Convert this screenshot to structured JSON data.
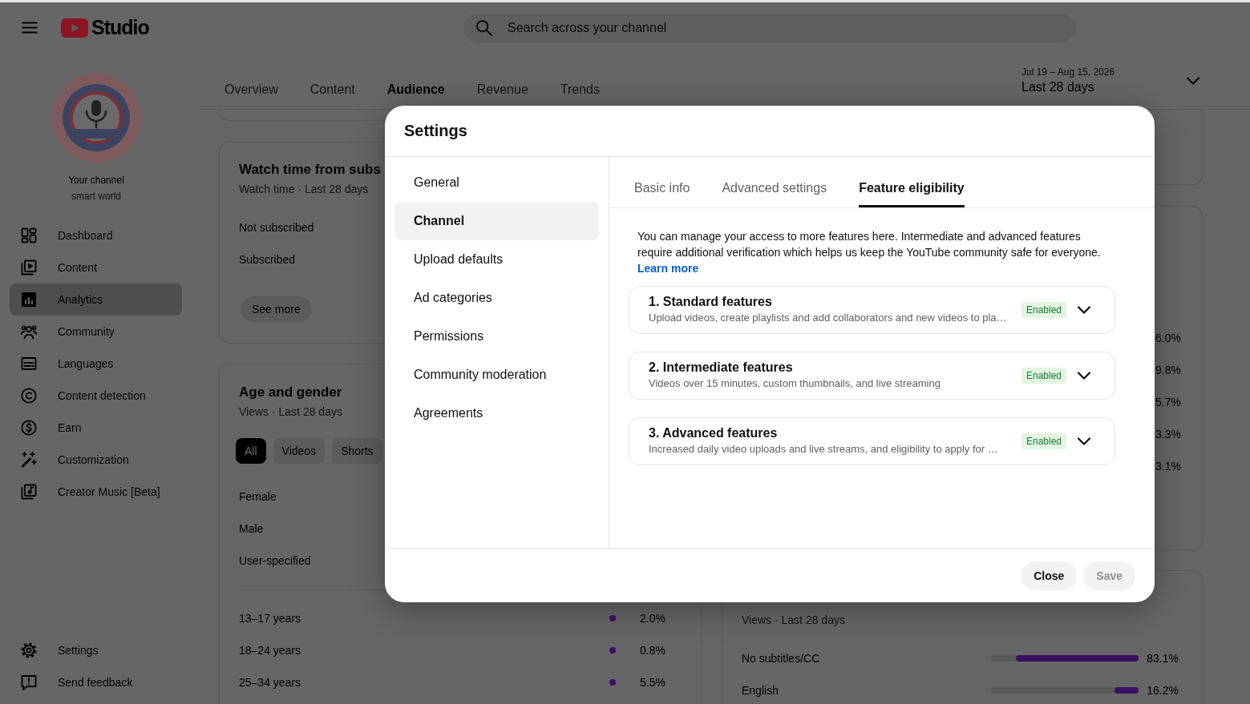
{
  "header": {
    "logo_text": "Studio",
    "search": {
      "placeholder": "Search across your channel"
    }
  },
  "sidebar": {
    "channel": {
      "label": "Your channel",
      "name": "smart world"
    },
    "items": [
      {
        "label": "Dashboard",
        "selected": false
      },
      {
        "label": "Content",
        "selected": false
      },
      {
        "label": "Analytics",
        "selected": true
      },
      {
        "label": "Community",
        "selected": false
      },
      {
        "label": "Languages",
        "selected": false
      },
      {
        "label": "Content detection",
        "selected": false
      },
      {
        "label": "Earn",
        "selected": false
      },
      {
        "label": "Customization",
        "selected": false
      },
      {
        "label": "Creator Music [Beta]",
        "selected": false
      }
    ],
    "footer_items": [
      {
        "label": "Settings",
        "selected": false
      },
      {
        "label": "Send feedback",
        "selected": false
      }
    ]
  },
  "tabs": [
    {
      "label": "Overview",
      "selected": false
    },
    {
      "label": "Content",
      "selected": false
    },
    {
      "label": "Audience",
      "selected": true
    },
    {
      "label": "Revenue",
      "selected": false
    },
    {
      "label": "Trends",
      "selected": false
    }
  ],
  "date_range": {
    "dates": "Jul 19 – Aug 15, 2026",
    "label": "Last 28 days"
  },
  "watch_time_card": {
    "title": "Watch time from subs",
    "subtitle": "Watch time · Last 28 days",
    "rows": [
      "Not subscribed",
      "Subscribed"
    ],
    "button": "See more"
  },
  "age_gender_card": {
    "title": "Age and gender",
    "subtitle": "Views · Last 28 days",
    "chips": [
      {
        "label": "All",
        "selected": true
      },
      {
        "label": "Videos",
        "selected": false
      },
      {
        "label": "Shorts",
        "selected": false
      }
    ],
    "gender_rows": [
      "Female",
      "Male",
      "User-specified"
    ],
    "age_rows": [
      {
        "label": "13–17 years",
        "value": "2.0%"
      },
      {
        "label": "18–24 years",
        "value": "0.8%"
      },
      {
        "label": "25–34 years",
        "value": "5.5%"
      }
    ]
  },
  "right_card": {
    "values": [
      "6.0%",
      "9.8%",
      "5.7%",
      "3.3%",
      "3.1%"
    ]
  },
  "subtitles_card": {
    "subtitle": "Views · Last 28 days",
    "rows": [
      {
        "label": "No subtitles/CC",
        "level": 0.831,
        "value": "83.1%"
      },
      {
        "label": "English",
        "level": 0.162,
        "value": "16.2%"
      }
    ]
  },
  "dialog": {
    "title": "Settings",
    "nav": [
      {
        "label": "General",
        "selected": false
      },
      {
        "label": "Channel",
        "selected": true
      },
      {
        "label": "Upload defaults",
        "selected": false
      },
      {
        "label": "Ad categories",
        "selected": false
      },
      {
        "label": "Permissions",
        "selected": false
      },
      {
        "label": "Community moderation",
        "selected": false
      },
      {
        "label": "Agreements",
        "selected": false
      }
    ],
    "tabs": [
      {
        "label": "Basic info",
        "selected": false
      },
      {
        "label": "Advanced settings",
        "selected": false
      },
      {
        "label": "Feature eligibility",
        "selected": true
      }
    ],
    "description": "You can manage your access to more features here. Intermediate and advanced features require additional verification which helps us keep the YouTube community safe for everyone.",
    "link": "Learn more",
    "features": [
      {
        "title": "1. Standard features",
        "description": "Upload videos, create playlists and add collaborators and new videos to pla…",
        "status": "Enabled",
        "expanded": false
      },
      {
        "title": "2. Intermediate features",
        "description": "Videos over 15 minutes, custom thumbnails, and live streaming",
        "status": "Enabled",
        "expanded": false
      },
      {
        "title": "3. Advanced features",
        "description": "Increased daily video uploads and live streams, and eligibility to apply for …",
        "status": "Enabled",
        "expanded": false
      }
    ],
    "buttons": [
      {
        "label": "Close",
        "disabled": false
      },
      {
        "label": "Save",
        "disabled": true
      }
    ]
  }
}
